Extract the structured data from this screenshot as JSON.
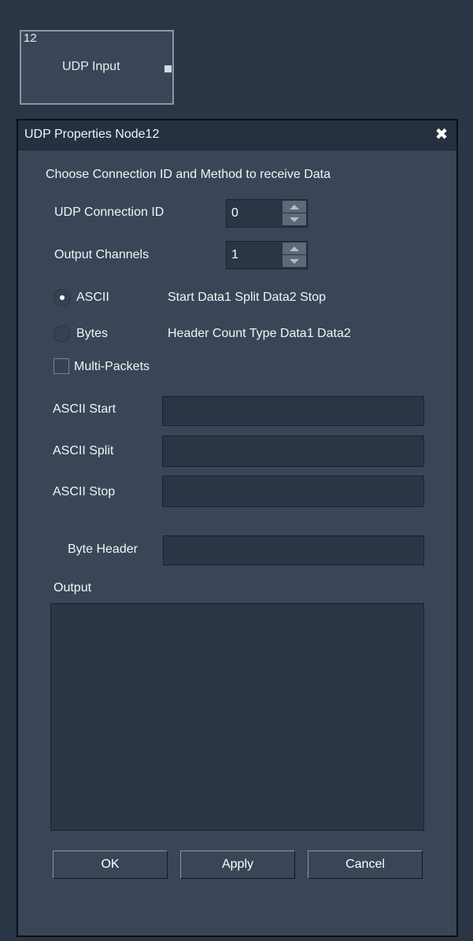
{
  "node": {
    "id": "12",
    "label": "UDP Input"
  },
  "dialog": {
    "title": "UDP Properties Node12",
    "close_glyph": "✖",
    "heading": "Choose Connection ID and Method to receive Data",
    "connection_id": {
      "label": "UDP Connection ID",
      "value": "0"
    },
    "output_channels": {
      "label": "Output Channels",
      "value": "1"
    },
    "ascii_option": {
      "label": "ASCII",
      "format": "Start Data1 Split Data2 Stop",
      "selected": true
    },
    "bytes_option": {
      "label": "Bytes",
      "format": "Header Count Type Data1 Data2",
      "selected": false
    },
    "multi_packets": {
      "label": "Multi-Packets",
      "checked": false
    },
    "ascii_start": {
      "label": "ASCII Start",
      "value": ""
    },
    "ascii_split": {
      "label": "ASCII Split",
      "value": ""
    },
    "ascii_stop": {
      "label": "ASCII Stop",
      "value": ""
    },
    "byte_header": {
      "label": "Byte Header",
      "value": ""
    },
    "output": {
      "label": "Output",
      "value": ""
    },
    "buttons": {
      "ok": "OK",
      "apply": "Apply",
      "cancel": "Cancel"
    }
  }
}
